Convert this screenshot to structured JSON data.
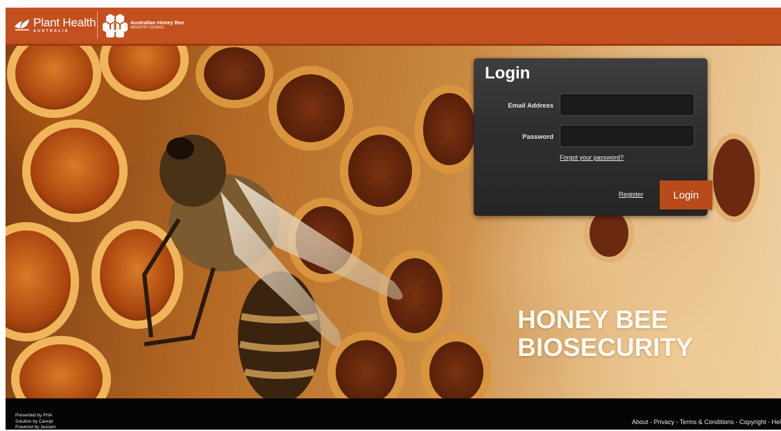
{
  "header": {
    "logo_pha": {
      "title": "Plant Health",
      "subtitle": "AUSTRALIA"
    },
    "logo_ahbic": {
      "title": "Australian Honey Bee",
      "subtitle": "INDUSTRY COUNCIL"
    },
    "colors": {
      "background": "#c4501f"
    }
  },
  "hero": {
    "title_line1": "HONEY BEE",
    "title_line2": "BIOSECURITY"
  },
  "login": {
    "heading": "Login",
    "email_label": "Email Address",
    "email_value": "",
    "password_label": "Password",
    "password_value": "",
    "forgot_password": "Forgot your password?",
    "register": "Register",
    "submit": "Login",
    "colors": {
      "panel": "#2f2f2f",
      "button": "#b84a1c"
    }
  },
  "footer": {
    "credits": [
      "Presented by PHA",
      "Solution by Canopi",
      "Powered by Jesisen"
    ],
    "links": [
      "About",
      "Privacy",
      "Terms & Conditions",
      "Copyright",
      "Hel"
    ],
    "separator": " - "
  }
}
